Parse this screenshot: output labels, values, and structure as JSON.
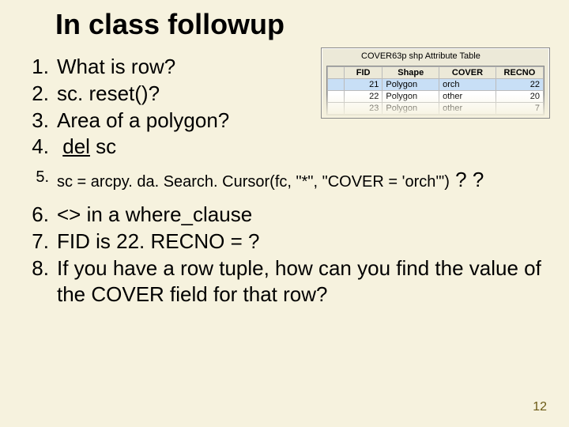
{
  "title": "In class followup",
  "items": {
    "i1": "What is row?",
    "i2": "sc. reset()?",
    "i3": "Area of a polygon?",
    "i4a": "del",
    "i4b": " sc",
    "i5a": "sc = arcpy. da. Search. Cursor(fc, \"*\", \"COVER = 'orch'\")",
    "i5b": " ? ?",
    "i6": "<> in a where_clause",
    "i7": "FID is 22. RECNO = ?",
    "i8": "If you have a row tuple, how can you find the value of the COVER field for that row?"
  },
  "page_number": "12",
  "inset": {
    "caption": "COVER63p shp Attribute Table",
    "headers": {
      "h0": "",
      "h1": "FID",
      "h2": "Shape",
      "h3": "COVER",
      "h4": "RECNO"
    },
    "rows": {
      "r0": {
        "fid": "21",
        "shape": "Polygon",
        "cover": "orch",
        "recno": "22"
      },
      "r1": {
        "fid": "22",
        "shape": "Polygon",
        "cover": "other",
        "recno": "20"
      },
      "r2": {
        "fid": "23",
        "shape": "Polygon",
        "cover": "other",
        "recno": "7"
      }
    }
  },
  "chart_data": {
    "type": "table",
    "title": "COVER63p shp Attribute Table",
    "columns": [
      "FID",
      "Shape",
      "COVER",
      "RECNO"
    ],
    "rows": [
      [
        21,
        "Polygon",
        "orch",
        22
      ],
      [
        22,
        "Polygon",
        "other",
        20
      ],
      [
        23,
        "Polygon",
        "other",
        7
      ]
    ],
    "selected_row_index": 0
  }
}
